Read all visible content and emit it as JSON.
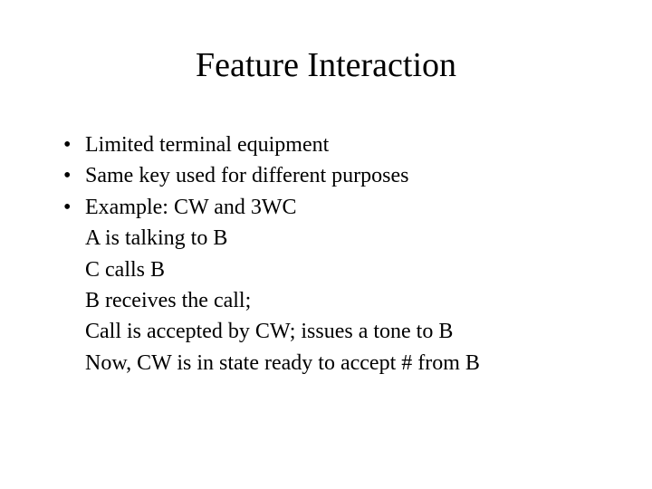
{
  "title": "Feature Interaction",
  "bullets": [
    "Limited terminal equipment",
    "Same key used for different purposes",
    "Example: CW and 3WC"
  ],
  "sublines": [
    "A is talking to B",
    "C calls B",
    "B receives the call;",
    "Call is accepted by CW; issues a tone to B",
    "Now, CW is in state ready to accept # from B"
  ]
}
